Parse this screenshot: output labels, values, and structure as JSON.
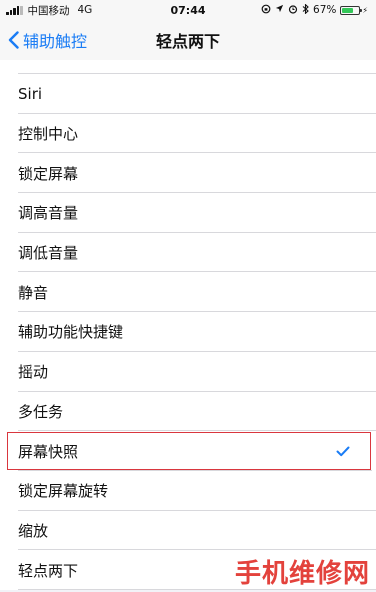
{
  "status_bar": {
    "carrier": "中国移动",
    "network": "4G",
    "time": "07:44",
    "battery_percent": "67%",
    "battery_level": 0.67,
    "battery_color": "#34c759"
  },
  "nav": {
    "back_label": "辅助触控",
    "title": "轻点两下",
    "accent_color": "#1a7cf5"
  },
  "options": [
    {
      "label": "Siri"
    },
    {
      "label": "控制中心"
    },
    {
      "label": "锁定屏幕"
    },
    {
      "label": "调高音量"
    },
    {
      "label": "调低音量"
    },
    {
      "label": "静音"
    },
    {
      "label": "辅助功能快捷键"
    },
    {
      "label": "摇动"
    },
    {
      "label": "多任务"
    },
    {
      "label": "屏幕快照",
      "selected": true
    },
    {
      "label": "锁定屏幕旋转"
    },
    {
      "label": "缩放"
    },
    {
      "label": "轻点两下"
    }
  ],
  "watermark": "手机维修网",
  "highlight_color": "#d9363e"
}
